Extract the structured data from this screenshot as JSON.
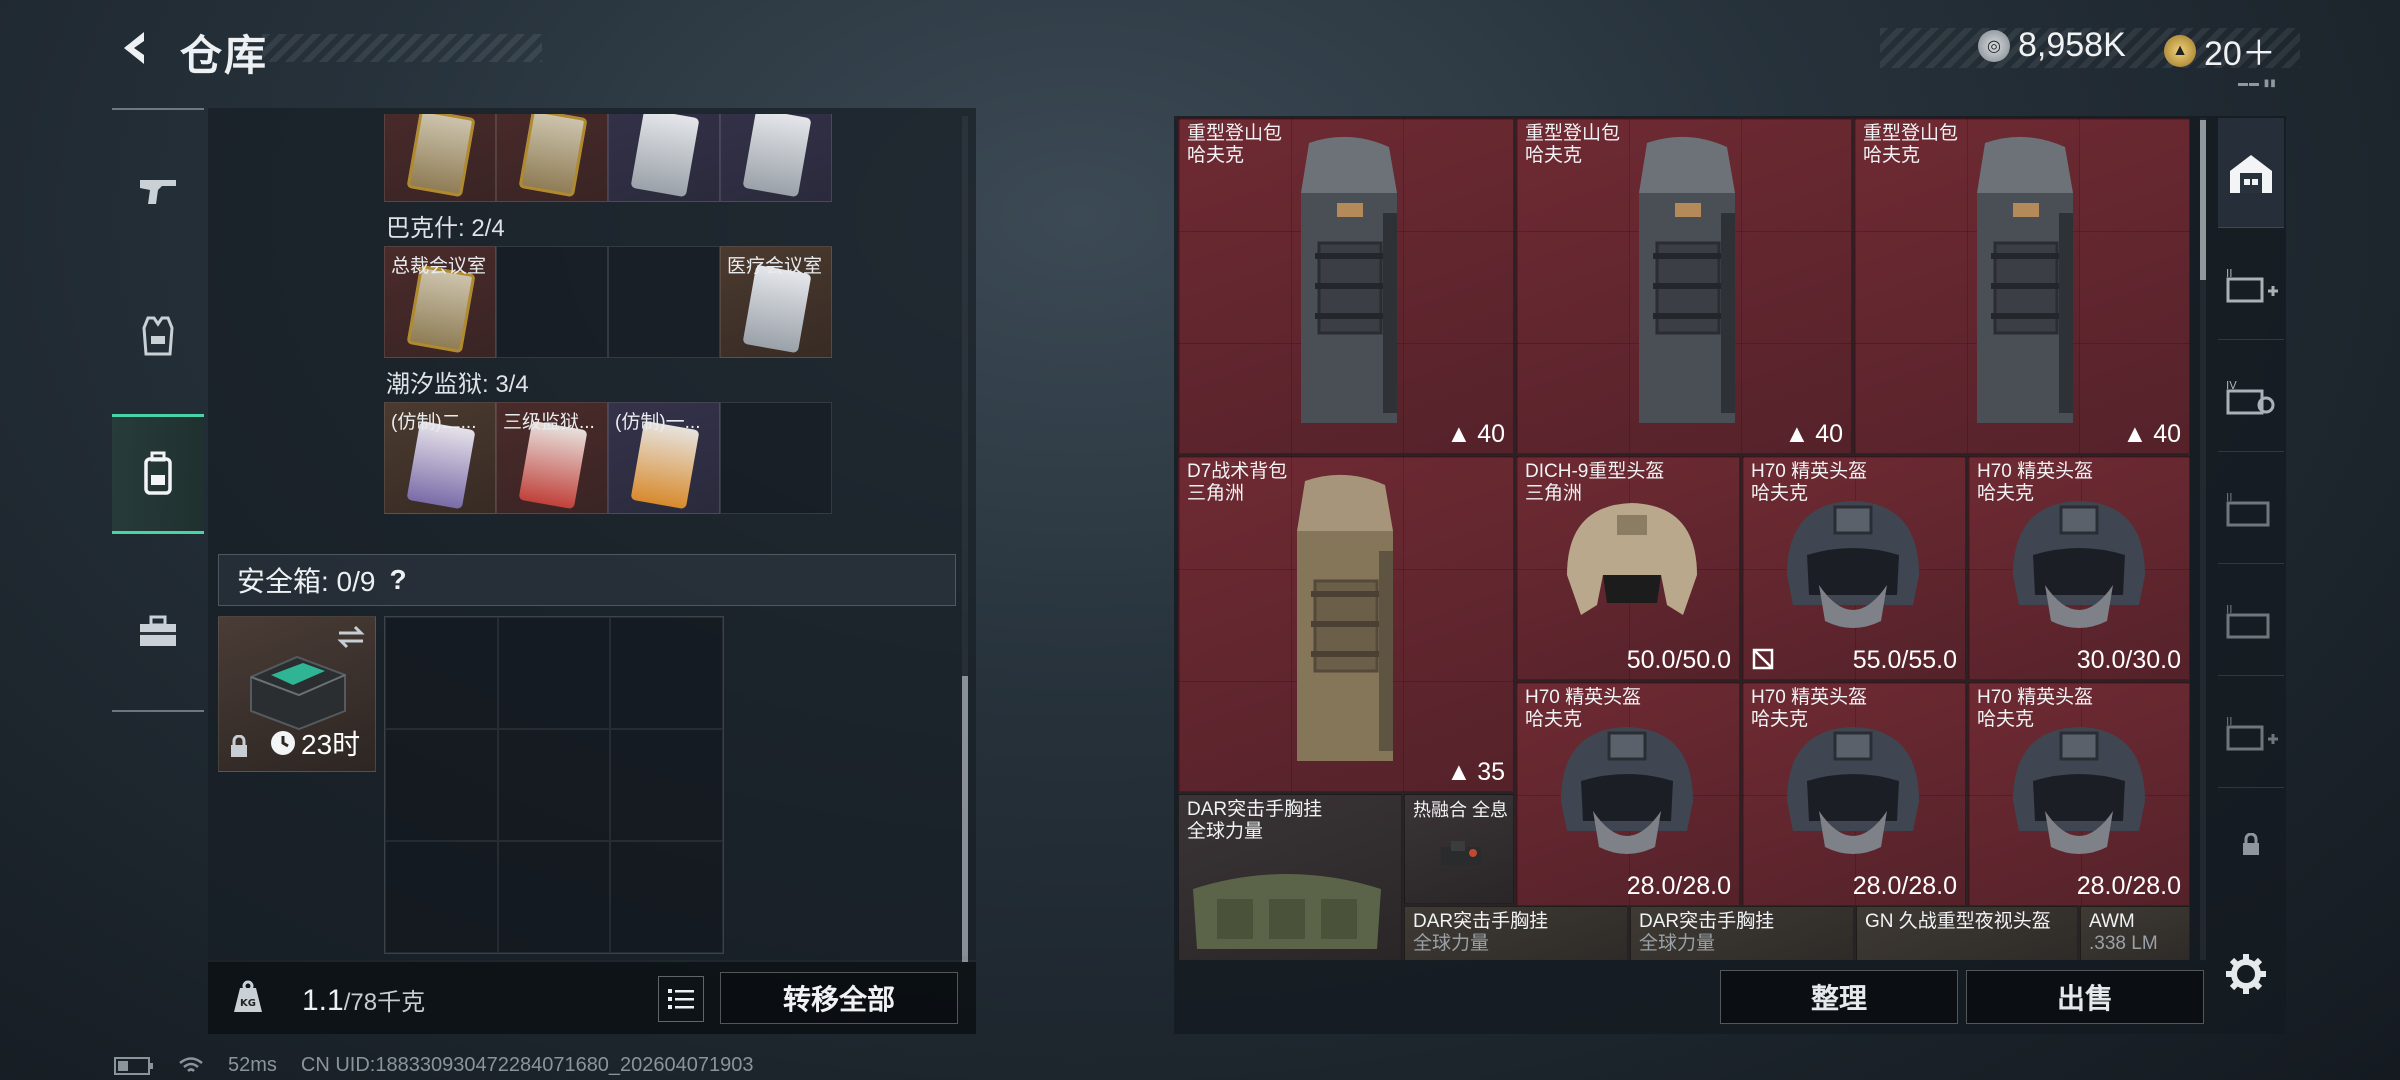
{
  "header": {
    "title": "仓库"
  },
  "currency": {
    "coins": "8,958K",
    "tickets": "20＋"
  },
  "nav": [
    "weapons",
    "armor",
    "backpack",
    "toolbox"
  ],
  "keys": {
    "row1": [
      {
        "label": "",
        "tone": "gold",
        "card": "gold"
      },
      {
        "label": "",
        "tone": "gold",
        "card": "gold"
      },
      {
        "label": "",
        "tone": "blue",
        "card": "silver"
      },
      {
        "label": "",
        "tone": "blue",
        "card": "silver"
      }
    ],
    "section2": "巴克什: 2/4",
    "row2": [
      {
        "label": "总裁会议室",
        "tone": "gold",
        "card": "gold"
      },
      {
        "label": "",
        "tone": "empty",
        "card": ""
      },
      {
        "label": "",
        "tone": "empty",
        "card": ""
      },
      {
        "label": "医疗会议室",
        "tone": "tan",
        "card": "silver"
      }
    ],
    "section3": "潮汐监狱: 3/4",
    "row3": [
      {
        "label": "(仿制)二...",
        "tone": "tan",
        "card": "purple"
      },
      {
        "label": "三级监狱...",
        "tone": "gold",
        "card": "red"
      },
      {
        "label": "(仿制)一...",
        "tone": "blue",
        "card": "orange"
      },
      {
        "label": "",
        "tone": "empty",
        "card": ""
      }
    ]
  },
  "safebox": {
    "title": "安全箱: 0/9",
    "help": "?",
    "timer": "23时"
  },
  "weight": {
    "current": "1.1",
    "max": "/78千克"
  },
  "buttons": {
    "transfer_all": "转移全部",
    "sort": "整理",
    "sell": "出售"
  },
  "inventory": [
    {
      "name": "重型登山包",
      "brand": "哈夫克",
      "stat": "40"
    },
    {
      "name": "重型登山包",
      "brand": "哈夫克",
      "stat": "40"
    },
    {
      "name": "重型登山包",
      "brand": "哈夫克",
      "stat": "40"
    },
    {
      "name": "D7战术背包",
      "brand": "三角洲",
      "stat": "35"
    },
    {
      "name": "DICH-9重型头盔",
      "brand": "三角洲",
      "stat": "50.0/50.0"
    },
    {
      "name": "H70 精英头盔",
      "brand": "哈夫克",
      "stat": "55.0/55.0"
    },
    {
      "name": "H70 精英头盔",
      "brand": "哈夫克",
      "stat": "30.0/30.0"
    },
    {
      "name": "H70 精英头盔",
      "brand": "哈夫克",
      "stat": "28.0/28.0"
    },
    {
      "name": "H70 精英头盔",
      "brand": "哈夫克",
      "stat": "28.0/28.0"
    },
    {
      "name": "H70 精英头盔",
      "brand": "哈夫克",
      "stat": "28.0/28.0"
    },
    {
      "name": "DAR突击手胸挂",
      "brand": "全球力量",
      "stat": ""
    },
    {
      "name": "热融合 全息",
      "brand": "",
      "stat": ""
    },
    {
      "name": "DAR突击手胸挂",
      "brand": "全球力量",
      "stat": ""
    },
    {
      "name": "DAR突击手胸挂",
      "brand": "全球力量",
      "stat": ""
    },
    {
      "name": "GN 久战重型夜视头盔",
      "brand": "",
      "stat": ""
    },
    {
      "name": "AWM",
      "brand": ".338 LM",
      "stat": ""
    }
  ],
  "side_tabs": [
    "home-storage",
    "II+",
    "IV",
    "II",
    "II",
    "II+",
    "lock"
  ],
  "status": {
    "ping": "52ms",
    "uid": "CN UID:1883309304722840716​80_202604071903"
  },
  "colors": {
    "accent": "#49d3a9",
    "item_bg": "#6f2a33"
  }
}
